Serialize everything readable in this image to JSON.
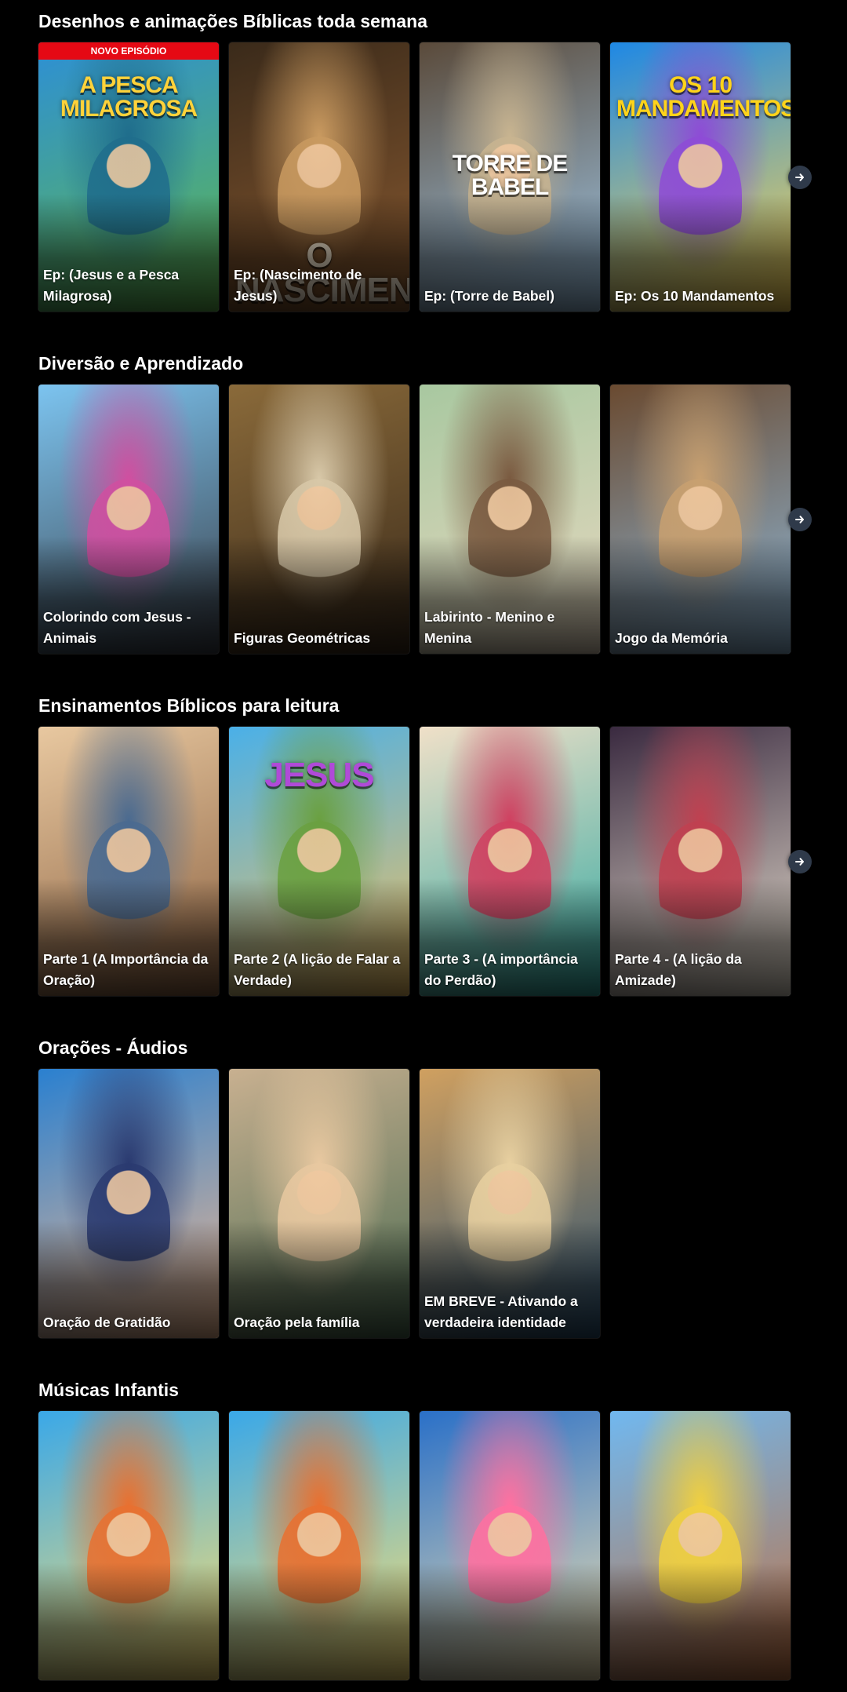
{
  "sections": [
    {
      "title": "Desenhos e animações Bíblicas toda semana",
      "cards": [
        {
          "label": "Ep: (Jesus e a Pesca Milagrosa)",
          "poster": "A PESCA MILAGROSA",
          "badge": "NOVO EPISÓDIO",
          "palette": [
            "#2d8fd6",
            "#5fb84c",
            "#1f6d8c"
          ],
          "poster_color": "#ffd23a"
        },
        {
          "label": "Ep: (Nascimento de Jesus)",
          "poster": "O NASCIMENTO",
          "palette": [
            "#3a2a1a",
            "#8a5a30",
            "#c99a60"
          ],
          "poster_color": "#f5e7d0"
        },
        {
          "label": "Ep: (Torre de Babel)",
          "poster": "TORRE DE BABEL",
          "palette": [
            "#5a4a3a",
            "#a0c8e8",
            "#c8b490"
          ],
          "poster_color": "#ffffff"
        },
        {
          "label": "Ep: Os 10 Mandamentos",
          "poster": "OS 10 MANDAMENTOS",
          "palette": [
            "#1e88e5",
            "#ffd54f",
            "#8e4bd6"
          ],
          "poster_color": "#ffd31a"
        }
      ],
      "has_next": true
    },
    {
      "title": "Diversão e Aprendizado",
      "cards": [
        {
          "label": "Colorindo com Jesus - Animais",
          "palette": [
            "#7cc4f0",
            "#3a3f48",
            "#d04fa0"
          ]
        },
        {
          "label": "Figuras Geométricas",
          "palette": [
            "#8a6a3a",
            "#3a2a1a",
            "#d8c8a8"
          ]
        },
        {
          "label": "Labirinto - Menino e Menina",
          "palette": [
            "#a8c8a0",
            "#e8d8c0",
            "#7a5a40"
          ]
        },
        {
          "label": "Jogo da Memória",
          "palette": [
            "#6a4a30",
            "#8fb8d8",
            "#c8a070"
          ]
        }
      ],
      "has_next": true
    },
    {
      "title": "Ensinamentos Bíblicos para leitura",
      "cards": [
        {
          "label": "Parte 1 (A Importância da Oração)",
          "palette": [
            "#e8c8a0",
            "#8a6040",
            "#4a6a90"
          ]
        },
        {
          "label": "Parte 2 (A lição de Falar a Verdade)",
          "poster": "JESUS",
          "palette": [
            "#4ab0e8",
            "#f0c060",
            "#6aa040"
          ],
          "poster_color": "#b04ad8"
        },
        {
          "label": "Parte 3 - (A importância do Perdão)",
          "palette": [
            "#f0e0c8",
            "#30a8a0",
            "#d04060"
          ]
        },
        {
          "label": "Parte 4 - (A lição da Amizade)",
          "palette": [
            "#3a2a40",
            "#e8e0d0",
            "#c04050"
          ]
        }
      ],
      "has_next": true
    },
    {
      "title": "Orações - Áudios",
      "cards": [
        {
          "label": "Oração de Gratidão",
          "palette": [
            "#2a80d0",
            "#f0b890",
            "#2a3a70"
          ]
        },
        {
          "label": "Oração pela família",
          "palette": [
            "#c8b090",
            "#4a6a50",
            "#e8c8a0"
          ]
        },
        {
          "label": "EM BREVE - Ativando a verdadeira identidade",
          "palette": [
            "#d0a060",
            "#2a5070",
            "#e8d0a0"
          ]
        }
      ],
      "has_next": false
    },
    {
      "title": "Músicas Infantis",
      "cards": [
        {
          "label": "",
          "palette": [
            "#3aa8e8",
            "#ffe070",
            "#e87030"
          ]
        },
        {
          "label": "",
          "palette": [
            "#3aa8e8",
            "#ffe070",
            "#e87030"
          ]
        },
        {
          "label": "",
          "palette": [
            "#2a70c8",
            "#f0e0b0",
            "#ff70a0"
          ]
        },
        {
          "label": "",
          "palette": [
            "#70b8f0",
            "#c07040",
            "#f0d040"
          ]
        }
      ],
      "has_next": false
    }
  ]
}
